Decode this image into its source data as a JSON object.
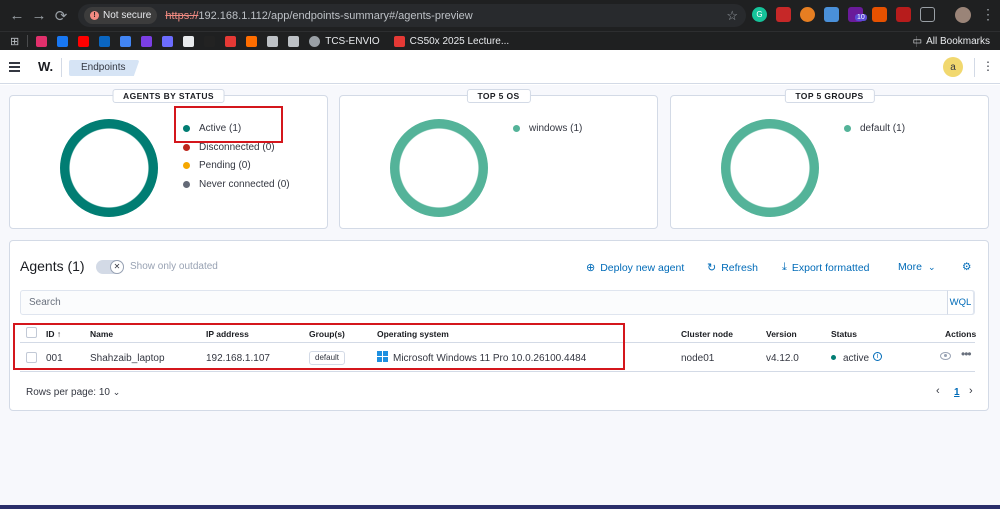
{
  "browser": {
    "nav": {
      "back": "←",
      "forward": "→",
      "reload": "⟳"
    },
    "security_label": "Not secure",
    "url_scheme": "https://",
    "url_rest": "192.168.1.112/app/endpoints-summary#/agents-preview",
    "ext_badge": "10",
    "bookmarks": [
      {
        "label": "TCS-ENVIO",
        "color": "#9aa0a6"
      },
      {
        "label": "CS50x 2025 Lecture...",
        "color": "#e53935"
      }
    ],
    "bookmark_icon_colors": [
      "#e1306c",
      "#1877f2",
      "#ff0000",
      "#0a66c2",
      "#4285f4",
      "#7b3fe4",
      "#6c6cff",
      "#e8eaed",
      "#222222",
      "#e53935",
      "#ff6d00",
      "#bdc1c6",
      "#bdc1c6"
    ],
    "all_bookmarks": "All Bookmarks"
  },
  "app": {
    "logo": "W.",
    "breadcrumb": "Endpoints",
    "avatar_letter": "a"
  },
  "status_panel": {
    "title": "AGENTS BY STATUS",
    "donut_color": "#017d73",
    "items": [
      {
        "label": "Active (1)",
        "color": "#017d73"
      },
      {
        "label": "Disconnected (0)",
        "color": "#bd271e"
      },
      {
        "label": "Pending (0)",
        "color": "#f5a700"
      },
      {
        "label": "Never connected (0)",
        "color": "#646a77"
      }
    ]
  },
  "os_panel": {
    "title": "TOP 5 OS",
    "donut_color": "#54b399",
    "items": [
      {
        "label": "windows (1)",
        "color": "#54b399"
      }
    ]
  },
  "groups_panel": {
    "title": "TOP 5 GROUPS",
    "donut_color": "#54b399",
    "items": [
      {
        "label": "default (1)",
        "color": "#54b399"
      }
    ]
  },
  "agents": {
    "title": "Agents (1)",
    "toggle_label": "Show only outdated",
    "actions": {
      "deploy": "Deploy new agent",
      "refresh": "Refresh",
      "export": "Export formatted",
      "more": "More"
    },
    "search_placeholder": "Search",
    "wql": "WQL",
    "columns": [
      "ID",
      "Name",
      "IP address",
      "Group(s)",
      "Operating system",
      "Cluster node",
      "Version",
      "Status",
      "Actions"
    ],
    "sort_arrow": "↑",
    "rows": [
      {
        "id": "001",
        "name": "Shahzaib_laptop",
        "ip": "192.168.1.107",
        "group": "default",
        "os": "Microsoft Windows 11 Pro 10.0.26100.4484",
        "cluster_node": "node01",
        "version": "v4.12.0",
        "status": "active"
      }
    ],
    "rows_per_page": "Rows per page: 10",
    "page": "1"
  }
}
